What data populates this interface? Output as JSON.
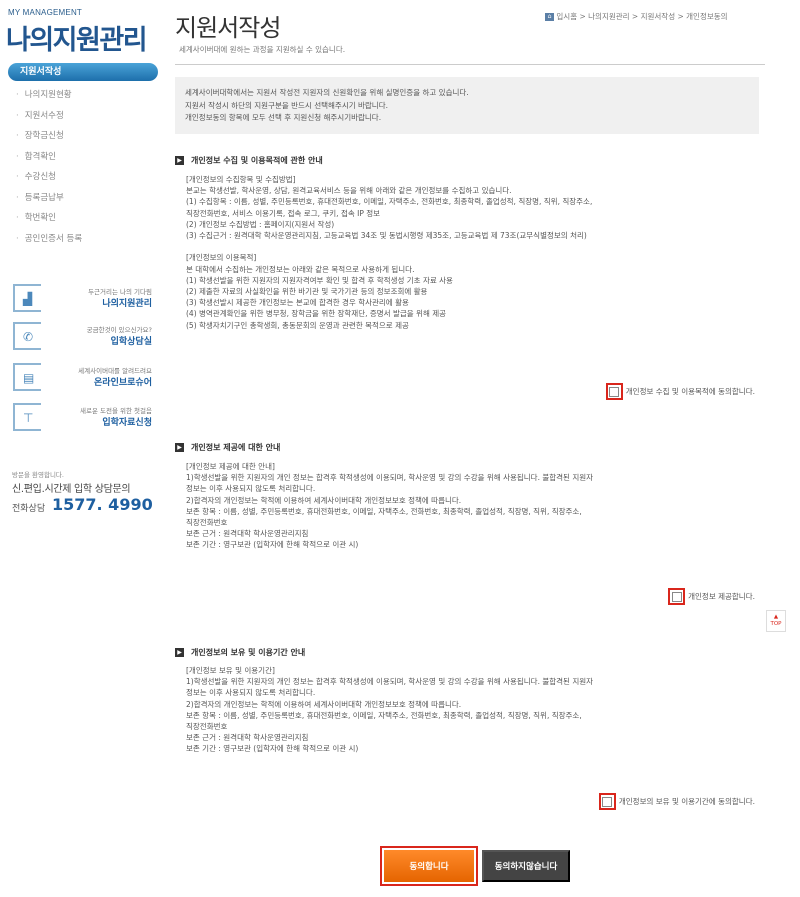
{
  "brand": {
    "sub": "MY MANAGEMENT",
    "title": "나의지원관리"
  },
  "nav": {
    "active": "지원서작성",
    "items": [
      "나의지원현황",
      "지원서수정",
      "장학금신청",
      "합격확인",
      "수강신청",
      "등록금납부",
      "학번확인",
      "공인인증서 등록"
    ]
  },
  "banners": [
    {
      "small": "두근거리는 나의 기다림",
      "big": "나의지원관리",
      "icon": "person-desk-icon"
    },
    {
      "small": "궁금한것이 있으신가요?",
      "big": "입학상담실",
      "icon": "phone-icon"
    },
    {
      "small": "세계사이버대를 알려드려요",
      "big": "온라인브로슈어",
      "icon": "brochure-icon"
    },
    {
      "small": "새로운 도전을 위한 첫걸음",
      "big": "입학자료신청",
      "icon": "shirt-icon"
    }
  ],
  "consult": {
    "small": "방문을 환영합니다.",
    "mid": "신.편입.시간제 입학 상담문의",
    "label": "전화상담",
    "phone": "1577. 4990"
  },
  "page": {
    "title": "지원서작성",
    "desc": "세계사이버대에 원하는 과정을 지원하실 수 있습니다.",
    "breadcrumb": "입시홈 > 나의지원관리 > 지원서작성 > 개인정보동의"
  },
  "notice": "세계사이버대학에서는 지원서 작성전 지원자의 신원확인을 위해 실명인증을 하고 있습니다.\n지원서 작성시 하단의 지원구분을 반드시 선택해주시기 바랍니다.\n개인정보동의 항목에 모두 선택 후 지원신청 해주시기바랍니다.",
  "sections": [
    {
      "heading": "개인정보 수집 및 이용목적에 관한 안내",
      "body": "[개인정보의 수집항목 및 수집방법]\n본교는 학생선발, 학사운영, 상담, 원격교육서비스 등을 위해 아래와 같은 개인정보를 수집하고 있습니다.\n(1) 수집항목 : 이름, 성별, 주민등록번호, 휴대전화번호, 이메일, 자택주소, 전화번호, 최종학력, 졸업성적, 직장명, 직위, 직장주소,\n직장전화번호, 서비스 이용기록, 접속 로그, 쿠키, 접속 IP 정보\n(2) 개인정보 수집방법 : 홈페이지(지원서 작성)\n(3) 수집근거 : 원격대학 학사운영관리지침, 고등교육법 34조 및 동법시행령 제35조, 고등교육법 제 73조(교무식별정보의 처리)\n\n[개인정보의 이용목적]\n본 대학에서 수집하는 개인정보는 아래와 같은 목적으로 사용하게 됩니다.\n(1) 학생선발을 위한 지원자의 지원자격여부 확인 및 합격 후 학적생성 기초 자료 사용\n(2) 제출한 자료의 사실확인을 위한 바기관 및 국가기관 등의 정보조회에 활용\n(3) 학생선발시 제공한 개인정보는 본교에 합격한 경우 학사관리에 활용\n(4) 병역관계확인을 위한 병무청, 장학금을 위한 장학재단, 증명서 발급을 위해 제공\n(5) 학생자치기구인 총학생회, 총동문회의 운영과 관련한 목적으로 제공",
      "agree": "개인정보 수집 및 이용목적에 동의합니다."
    },
    {
      "heading": "개인정보 제공에 대한 안내",
      "body": "[개인정보 제공에 대한 안내]\n1)학생선발을 위한 지원자의 개인 정보는 합격후 학적생성에 이용되며, 학사운영 및 강의 수강을 위해 사용됩니다. 불합격된 지원자\n정보는 이후 사용되지 않도록 처리합니다.\n2)합격자의 개인정보는 학적에 이용하여 세계사이버대학 개인정보보호 정책에 따릅니다.\n보존 항목 : 이름, 성별, 주민등록번호, 휴대전화번호, 이메일, 자택주소, 전화번호, 최종학력, 졸업성적, 직장명, 직위, 직장주소,\n직장전화번호\n보존 근거 : 원격대학 학사운영관리지침\n보존 기간 : 영구보관 (입학자에 한해 학적으로 이관 시)",
      "agree": "개인정보 제공합니다."
    },
    {
      "heading": "개인정보의 보유 및 이용기간 안내",
      "body": "[개인정보 보유 및 이용기간]\n1)학생선발을 위한 지원자의 개인 정보는 합격후 학적생성에 이용되며, 학사운영 및 강의 수강을 위해 사용됩니다. 불합격된 지원자\n정보는 이후 사용되지 않도록 처리합니다.\n2)합격자의 개인정보는 학적에 이용하여 세계사이버대학 개인정보보호 정책에 따릅니다.\n보존 항목 : 이름, 성별, 주민등록번호, 휴대전화번호, 이메일, 자택주소, 전화번호, 최종학력, 졸업성적, 직장명, 직위, 직장주소,\n직장전화번호\n보존 근거 : 원격대학 학사운영관리지침\n보존 기간 : 영구보관 (입학자에 한해 학적으로 이관 시)",
      "agree": "개인정보의 보유 및 이용기간에 동의합니다."
    }
  ],
  "buttons": {
    "agree": "동의합니다",
    "disagree": "동의하지않습니다"
  },
  "top": "TOP",
  "colors": {
    "accent": "#1e5fa0",
    "highlight": "#d9261c",
    "button": "#e56400"
  }
}
